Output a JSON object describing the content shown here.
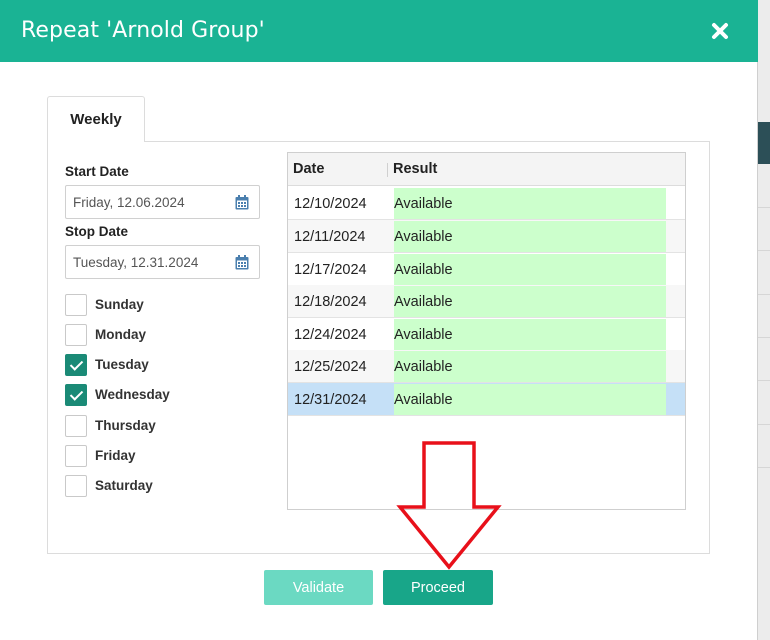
{
  "dialog": {
    "title": "Repeat 'Arnold Group'",
    "header_color": "#1ab394",
    "close_icon": "close-icon"
  },
  "tabs": [
    {
      "label": "Weekly",
      "active": true
    }
  ],
  "form": {
    "start_label": "Start Date",
    "start_value": "Friday, 12.06.2024",
    "stop_label": "Stop Date",
    "stop_value": "Tuesday, 12.31.2024",
    "calendar_icon": "calendar-icon",
    "days": [
      {
        "label": "Sunday",
        "checked": false
      },
      {
        "label": "Monday",
        "checked": false
      },
      {
        "label": "Tuesday",
        "checked": true
      },
      {
        "label": "Wednesday",
        "checked": true
      },
      {
        "label": "Thursday",
        "checked": false
      },
      {
        "label": "Friday",
        "checked": false
      },
      {
        "label": "Saturday",
        "checked": false
      }
    ]
  },
  "grid": {
    "columns": [
      "Date",
      "Result"
    ],
    "rows": [
      {
        "date": "12/10/2024",
        "result": "Available"
      },
      {
        "date": "12/11/2024",
        "result": "Available"
      },
      {
        "date": "12/17/2024",
        "result": "Available"
      },
      {
        "date": "12/18/2024",
        "result": "Available"
      },
      {
        "date": "12/24/2024",
        "result": "Available"
      },
      {
        "date": "12/25/2024",
        "result": "Available"
      },
      {
        "date": "12/31/2024",
        "result": "Available",
        "selected": true
      }
    ],
    "available_color": "#ccffcc",
    "selected_color": "#c5e0f7"
  },
  "buttons": {
    "validate": "Validate",
    "proceed": "Proceed",
    "proceed_color": "#18a689",
    "validate_color": "#6bd9c2"
  },
  "annotation": {
    "arrow_icon": "down-arrow-icon",
    "arrow_color": "#e8101a"
  }
}
